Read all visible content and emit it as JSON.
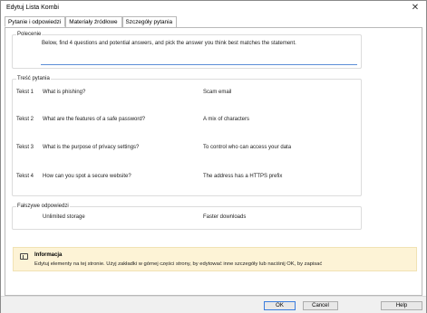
{
  "window": {
    "title": "Edytuj Lista Kombi",
    "close_glyph": "✕"
  },
  "tabs": [
    {
      "label": "Pytanie i odpowiedzi",
      "active": true
    },
    {
      "label": "Materiały źródłowe",
      "active": false
    },
    {
      "label": "Szczegóły pytania",
      "active": false
    }
  ],
  "polecenie": {
    "legend": "Polecenie",
    "text": "Below, find 4 questions and potential answers, and pick the answer you think best matches the statement."
  },
  "tresc": {
    "legend": "Treść pytania",
    "rows": [
      {
        "label": "Tekst 1",
        "question": "What is phishing?",
        "answer": "Scam email"
      },
      {
        "label": "Tekst 2",
        "question": "What are the features of a safe password?",
        "answer": "A mix of characters"
      },
      {
        "label": "Tekst 3",
        "question": "What is the purpose of privacy settings?",
        "answer": "To control who can access your data"
      },
      {
        "label": "Tekst 4",
        "question": "How can you spot a secure website?",
        "answer": "The address has a HTTPS prefix"
      }
    ]
  },
  "falszywe": {
    "legend": "Fałszywe odpowiedzi",
    "items": [
      "Unlimited storage",
      "Faster downloads"
    ]
  },
  "info": {
    "title": "Informacja",
    "text": "Edytuj elementy na tej stronie. Użyj zakładki w górnej części strony, by edytować inne szczegóły lub naciśnij OK, by zapisać",
    "background": "#fdf3d6"
  },
  "footer": {
    "ok_label": "OK",
    "cancel_label": "Cancel",
    "help_label": "Help",
    "accent": "#3b7ddd"
  }
}
